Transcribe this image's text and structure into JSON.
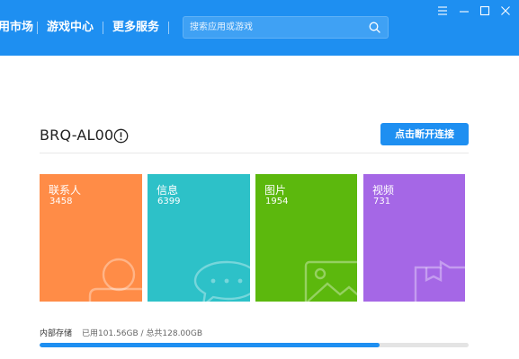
{
  "header": {
    "nav": [
      {
        "label": "用市场"
      },
      {
        "label": "游戏中心"
      },
      {
        "label": "更多服务"
      }
    ],
    "search": {
      "placeholder": "搜索应用或游戏",
      "icon": "search-icon"
    },
    "window_controls": [
      "menu-icon",
      "minimize-icon",
      "maximize-icon",
      "close-icon"
    ],
    "accent_color": "#1e8ff1"
  },
  "device": {
    "name": "BRQ-AL00",
    "info_icon": "info-icon",
    "disconnect_label": "点击断开连接"
  },
  "tiles": [
    {
      "label": "联系人",
      "count": "3458",
      "color": "#ff8c47",
      "icon": "contact-icon"
    },
    {
      "label": "信息",
      "count": "6399",
      "color": "#2dc1c8",
      "icon": "message-icon"
    },
    {
      "label": "图片",
      "count": "1954",
      "color": "#5cb80d",
      "icon": "image-icon"
    },
    {
      "label": "视频",
      "count": "731",
      "color": "#a567e6",
      "icon": "video-icon"
    }
  ],
  "storage": {
    "label": "内部存储",
    "value_text": "已用101.56GB / 总共128.00GB",
    "used_gb": 101.56,
    "total_gb": 128.0
  }
}
